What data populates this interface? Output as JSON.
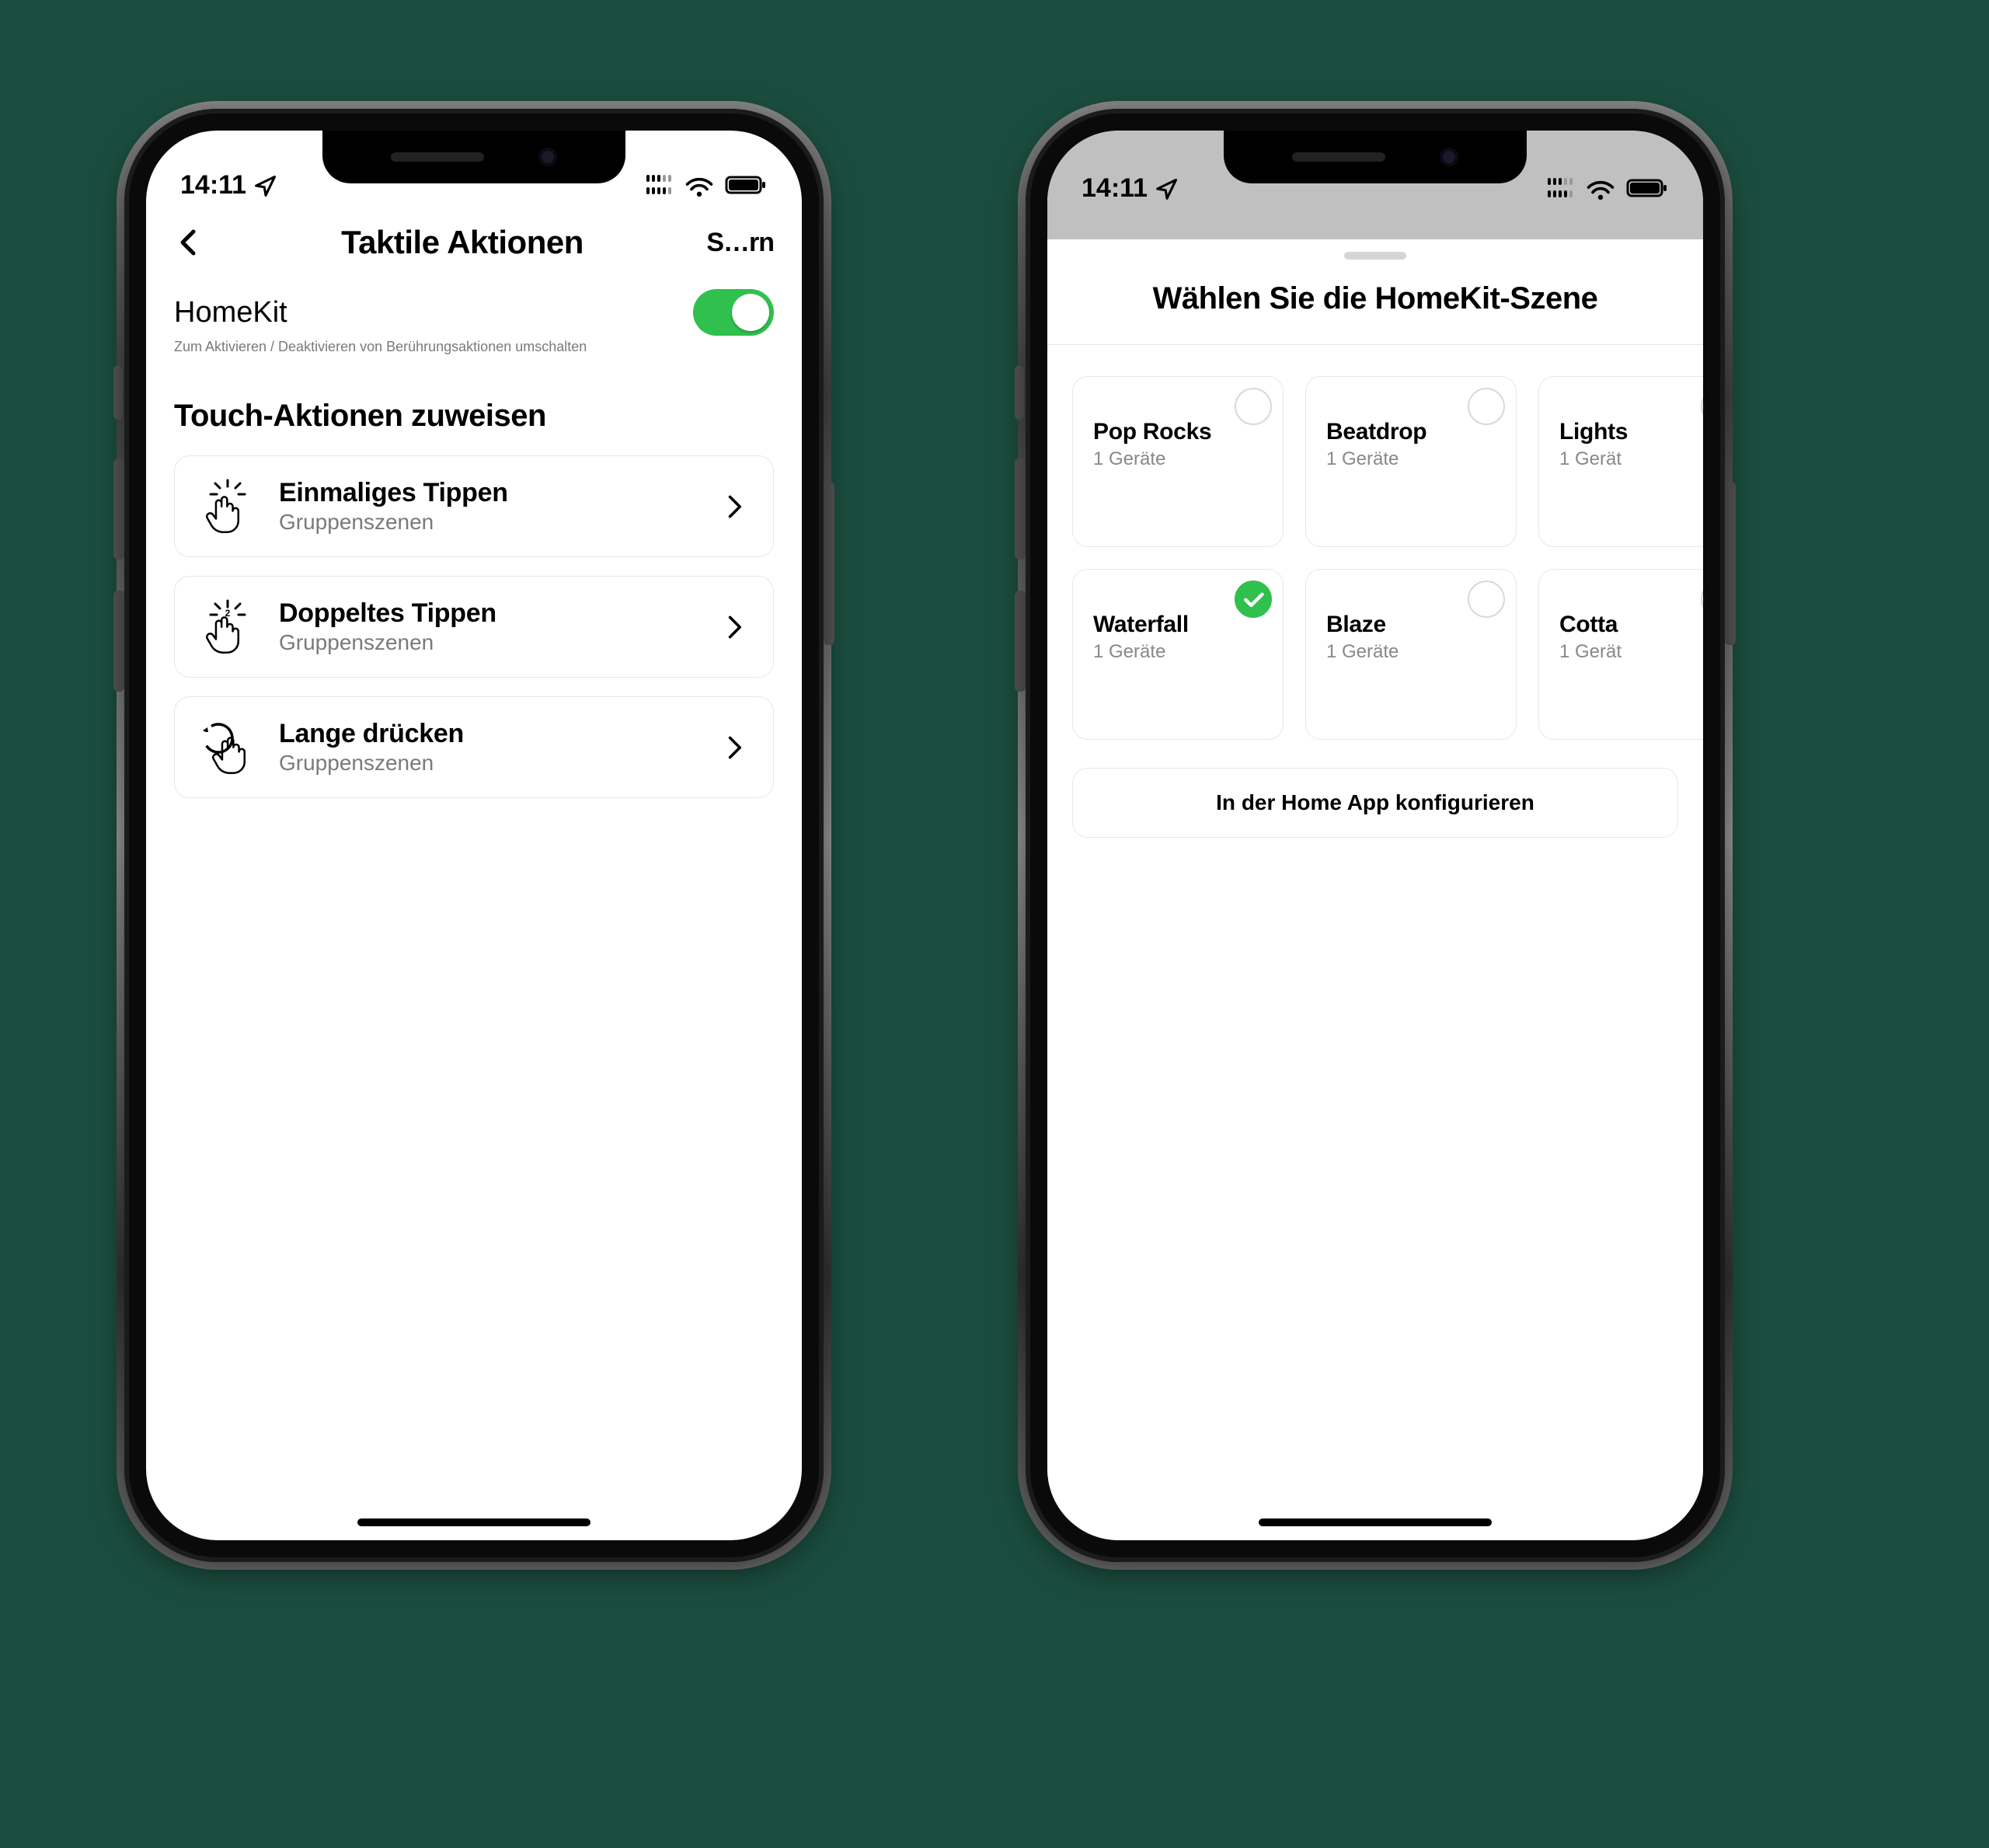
{
  "accent_color": "#30c04d",
  "device": {
    "home_indicator_color": "#000000"
  },
  "status_bar": {
    "time": "14:11",
    "location_icon": "location-arrow",
    "dual_sim_icon": "dual-sim-signal",
    "wifi_icon": "wifi",
    "battery_icon": "battery-full"
  },
  "screen1": {
    "nav": {
      "back_icon": "chevron-left",
      "title": "Taktile Aktionen",
      "action": "S…rn"
    },
    "homekit": {
      "label": "HomeKit",
      "enabled": true,
      "hint": "Zum Aktivieren / Deaktivieren von Berührungsaktionen umschalten"
    },
    "section_title": "Touch-Aktionen zuweisen",
    "actions": [
      {
        "icon": "single-tap",
        "title": "Einmaliges Tippen",
        "subtitle": "Gruppenszenen"
      },
      {
        "icon": "double-tap",
        "title": "Doppeltes Tippen",
        "subtitle": "Gruppenszenen"
      },
      {
        "icon": "long-press",
        "title": "Lange drücken",
        "subtitle": "Gruppenszenen"
      }
    ]
  },
  "screen2": {
    "title": "Wählen Sie die HomeKit-Szene",
    "scenes": [
      {
        "name": "Pop Rocks",
        "devices": "1 Geräte",
        "selected": false
      },
      {
        "name": "Beatdrop",
        "devices": "1 Geräte",
        "selected": false
      },
      {
        "name": "Lights",
        "devices": "1 Gerät",
        "selected": false
      },
      {
        "name": "Waterfall",
        "devices": "1 Geräte",
        "selected": true
      },
      {
        "name": "Blaze",
        "devices": "1 Geräte",
        "selected": false
      },
      {
        "name": "Cotta",
        "devices": "1 Gerät",
        "selected": false
      }
    ],
    "configure_button": "In der Home App konfigurieren"
  }
}
